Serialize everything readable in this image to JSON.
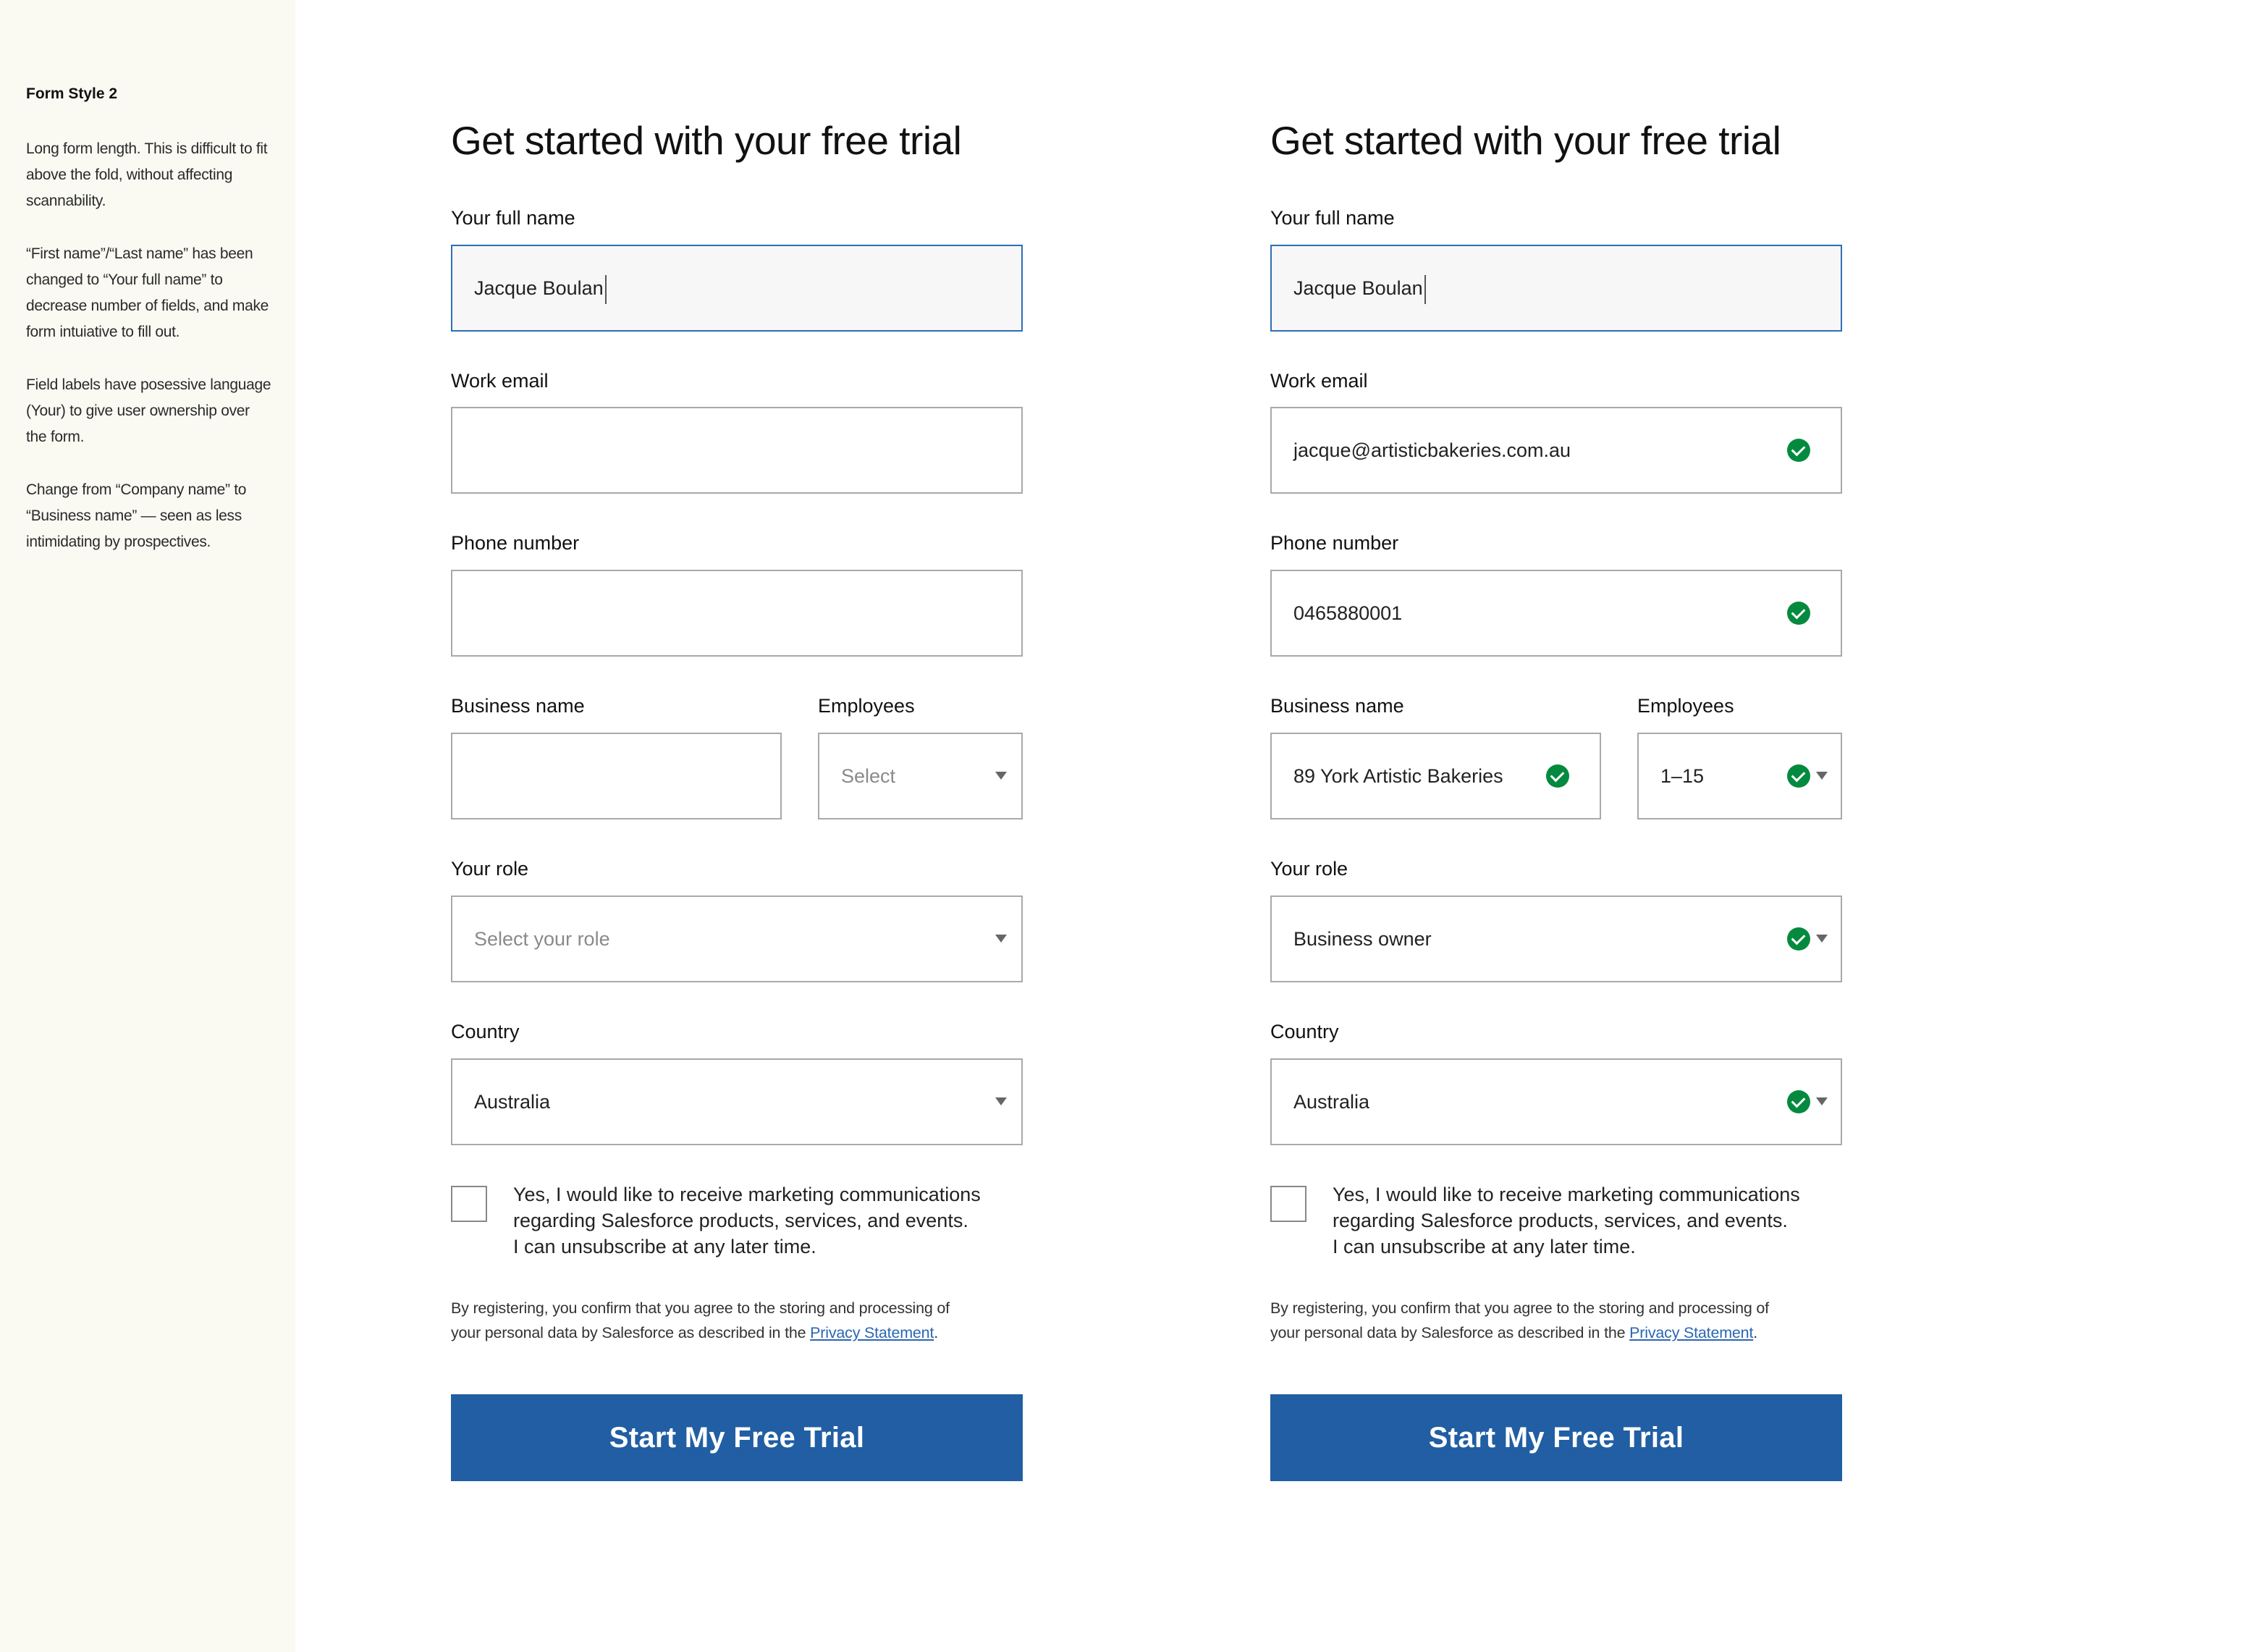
{
  "sidebar": {
    "title": "Form Style 2",
    "notes": [
      "Long form length. This is difficult to fit above the fold, without affecting scannability.",
      "“First name”/“Last name” has been changed to “Your full name” to decrease number of fields, and make form intuiative to fill out.",
      "Field labels have posessive language (Your) to give user ownership over the form.",
      "Change from “Company name” to “Business name” — seen as less intimidating by prospectives."
    ]
  },
  "forms": [
    {
      "heading": "Get started with your free trial",
      "labels": {
        "full_name": "Your full name",
        "email": "Work email",
        "phone": "Phone number",
        "business": "Business name",
        "employees": "Employees",
        "role": "Your role",
        "country": "Country"
      },
      "values": {
        "full_name": "Jacque Boulan",
        "email": "",
        "phone": "",
        "business": "",
        "employees": "Select",
        "role": "Select your role",
        "country": "Australia"
      },
      "marketing_lines": [
        "Yes, I would like to receive marketing communications",
        "regarding Salesforce products, services, and events.",
        "I can unsubscribe at any later time."
      ],
      "consent_line1": "By registering, you confirm that you agree to the storing and processing of",
      "consent_line2": "your personal data by Salesforce as described in the ",
      "privacy_link": "Privacy Statement",
      "consent_end": ".",
      "submit": "Start My Free Trial"
    },
    {
      "heading": "Get started with your free trial",
      "labels": {
        "full_name": "Your full name",
        "email": "Work email",
        "phone": "Phone number",
        "business": "Business name",
        "employees": "Employees",
        "role": "Your role",
        "country": "Country"
      },
      "values": {
        "full_name": "Jacque Boulan",
        "email": "jacque@artisticbakeries.com.au",
        "phone": "0465880001",
        "business": "89 York Artistic Bakeries",
        "employees": "1–15",
        "role": "Business owner",
        "country": "Australia"
      },
      "marketing_lines": [
        "Yes, I would like to receive marketing communications",
        "regarding Salesforce products, services, and events.",
        "I can unsubscribe at any later time."
      ],
      "consent_line1": "By registering, you confirm that you agree to the storing and processing of",
      "consent_line2": "your personal data by Salesforce as described in the ",
      "privacy_link": "Privacy Statement",
      "consent_end": ".",
      "submit": "Start My Free Trial"
    }
  ],
  "colors": {
    "sidebar_bg": "#fafaf3",
    "accent_button": "#215ea3",
    "active_field_border": "#2d6fb5",
    "valid_check": "#048a3f",
    "link": "#2b66b3"
  },
  "icons": {
    "valid": "check-circle-icon",
    "dropdown": "caret-down-icon"
  }
}
